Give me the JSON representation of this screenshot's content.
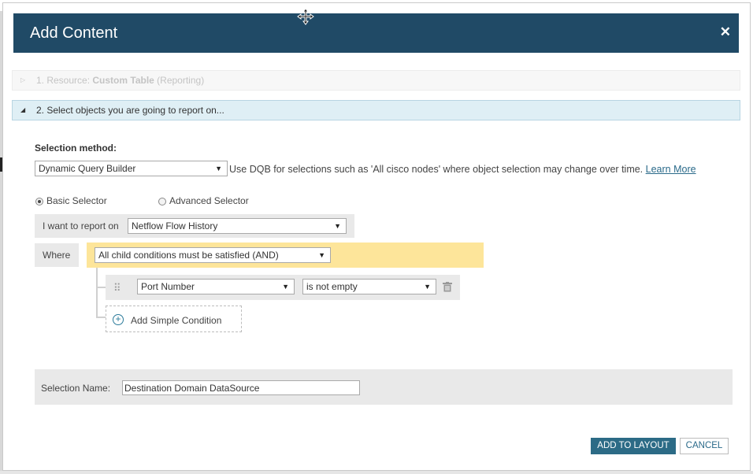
{
  "dialog": {
    "title": "Add Content",
    "close_icon": "close-icon"
  },
  "steps": [
    {
      "prefix": "1. Resource: ",
      "name": "Custom Table",
      "suffix": " (Reporting)",
      "expanded": false
    },
    {
      "label": "2. Select objects you are going to report on...",
      "expanded": true
    }
  ],
  "selection": {
    "method_label": "Selection method:",
    "method_value": "Dynamic Query Builder",
    "dqb_hint": "Use DQB for selections such as 'All cisco nodes' where object selection may change over time.",
    "learn_more": "Learn More",
    "basic_selector": "Basic Selector",
    "advanced_selector": "Advanced Selector",
    "selected_mode": "basic"
  },
  "report": {
    "label": "I want to report on",
    "value": "Netflow Flow History"
  },
  "where": {
    "label": "Where",
    "condition_mode": "All child conditions must be satisfied (AND)"
  },
  "condition": {
    "field": "Port Number",
    "operator": "is not empty"
  },
  "add_condition": "Add Simple Condition",
  "name": {
    "label": "Selection Name:",
    "value": "Destination Domain DataSource"
  },
  "buttons": {
    "add": "ADD TO LAYOUT",
    "cancel": "CANCEL"
  },
  "colors": {
    "header": "#204a66",
    "accent": "#2c6b86",
    "where_highlight": "#fde59a"
  }
}
